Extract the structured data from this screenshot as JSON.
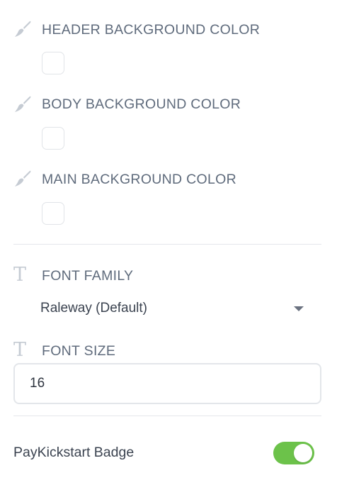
{
  "colors": {
    "header_background": {
      "label": "HEADER BACKGROUND COLOR",
      "icon": "brush-icon",
      "value": "#ffffff"
    },
    "body_background": {
      "label": "BODY BACKGROUND COLOR",
      "icon": "brush-icon",
      "value": "#ffffff"
    },
    "main_background": {
      "label": "MAIN BACKGROUND COLOR",
      "icon": "brush-icon",
      "value": "#ffffff"
    }
  },
  "typography": {
    "font_family": {
      "label": "FONT FAMILY",
      "icon": "text-icon",
      "selected": "Raleway (Default)"
    },
    "font_size": {
      "label": "FONT SIZE",
      "icon": "text-icon",
      "value": "16"
    }
  },
  "badge": {
    "label": "PayKickstart Badge",
    "enabled": true,
    "toggle_color": "#6cc24a"
  }
}
